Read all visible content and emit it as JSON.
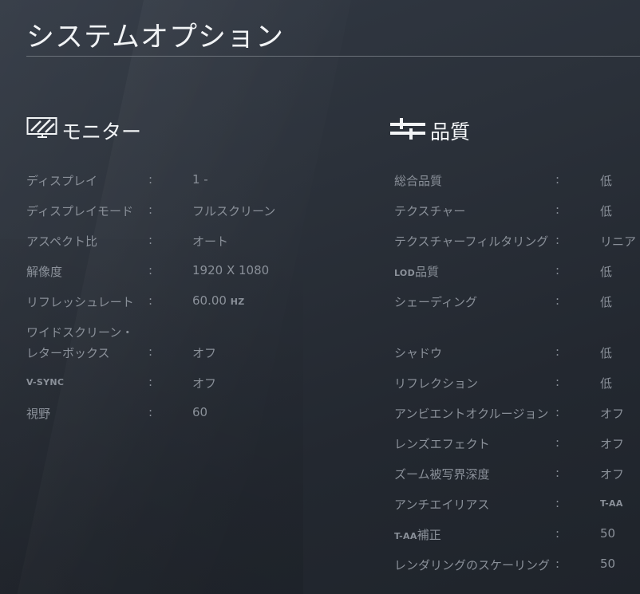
{
  "page": {
    "title": "システムオプション"
  },
  "monitor": {
    "header": "モニター",
    "icon": "monitor-icon",
    "rows": [
      {
        "label": "ディスプレイ",
        "value": "1 -"
      },
      {
        "label": "ディスプレイモード",
        "value": "フルスクリーン"
      },
      {
        "label": "アスペクト比",
        "value": "オート"
      },
      {
        "label": "解像度",
        "value": "1920 X 1080"
      },
      {
        "label": "リフレッシュレート",
        "value_num": "60.00",
        "value_unit": "HZ"
      },
      {
        "label_line1": "ワイドスクリーン・",
        "label_line2": "レターボックス",
        "value": "オフ"
      },
      {
        "label": "V-SYNC",
        "value": "オフ"
      },
      {
        "label": "視野",
        "value": "60"
      }
    ]
  },
  "quality": {
    "header": "品質",
    "icon": "sliders-icon",
    "rows": [
      {
        "label": "総合品質",
        "value": "低"
      },
      {
        "label": "テクスチャー",
        "value": "低"
      },
      {
        "label": "テクスチャーフィルタリング",
        "value": "リニア"
      },
      {
        "label_prefix": "LOD",
        "label_suffix": "品質",
        "value": "低"
      },
      {
        "label": "シェーディング",
        "value": "低"
      },
      {
        "label": "シャドウ",
        "value": "低"
      },
      {
        "label": "リフレクション",
        "value": "低"
      },
      {
        "label": "アンビエントオクルージョン",
        "value": "オフ"
      },
      {
        "label": "レンズエフェクト",
        "value": "オフ"
      },
      {
        "label": "ズーム被写界深度",
        "value": "オフ"
      },
      {
        "label": "アンチエイリアス",
        "value": "T-AA"
      },
      {
        "label_prefix": "T-AA",
        "label_suffix": "補正",
        "value": "50"
      },
      {
        "label": "レンダリングのスケーリング",
        "value": "50"
      }
    ]
  },
  "colon": ":"
}
